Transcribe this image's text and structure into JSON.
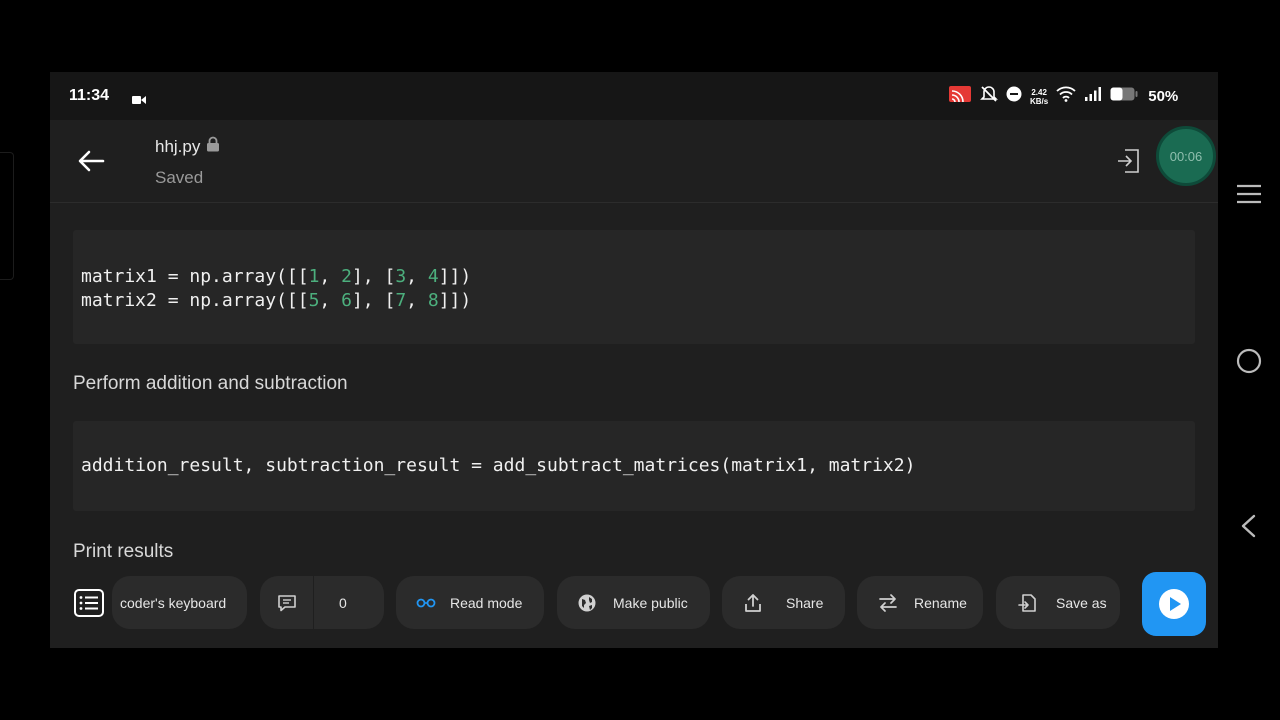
{
  "status_bar": {
    "time": "11:34",
    "net_speed_value": "2.42",
    "net_speed_unit": "KB/s",
    "battery": "50%",
    "icons": [
      "screen-record-icon",
      "cast-icon",
      "mute-icon",
      "dnd-icon",
      "wifi-icon",
      "signal-icon",
      "battery-icon"
    ]
  },
  "header": {
    "filename": "hhj.py",
    "status": "Saved",
    "recorder_time": "00:06"
  },
  "content": {
    "code1": {
      "line1": {
        "pre": "matrix1 = np.array([[",
        "n1": "1",
        "mid1": ", ",
        "n2": "2",
        "mid2": "], [",
        "n3": "3",
        "mid3": ", ",
        "n4": "4",
        "post": "]])"
      },
      "line2": {
        "pre": "matrix2 = np.array([[",
        "n1": "5",
        "mid1": ", ",
        "n2": "6",
        "mid2": "], [",
        "n3": "7",
        "mid3": ", ",
        "n4": "8",
        "post": "]])"
      }
    },
    "heading1": "Perform addition and subtraction",
    "code2": "addition_result, subtraction_result = add_subtract_matrices(matrix1, matrix2)",
    "heading2": "Print results"
  },
  "toolbar": {
    "keyboard_label": "coder's keyboard",
    "comments_count": "0",
    "read_mode": "Read mode",
    "make_public": "Make public",
    "share": "Share",
    "rename": "Rename",
    "save_as": "Save as"
  },
  "colors": {
    "app_bg": "#1f1f1f",
    "code_bg": "#262626",
    "number": "#4caf7d",
    "accent": "#2196f3",
    "recorder": "#1a6b52"
  }
}
